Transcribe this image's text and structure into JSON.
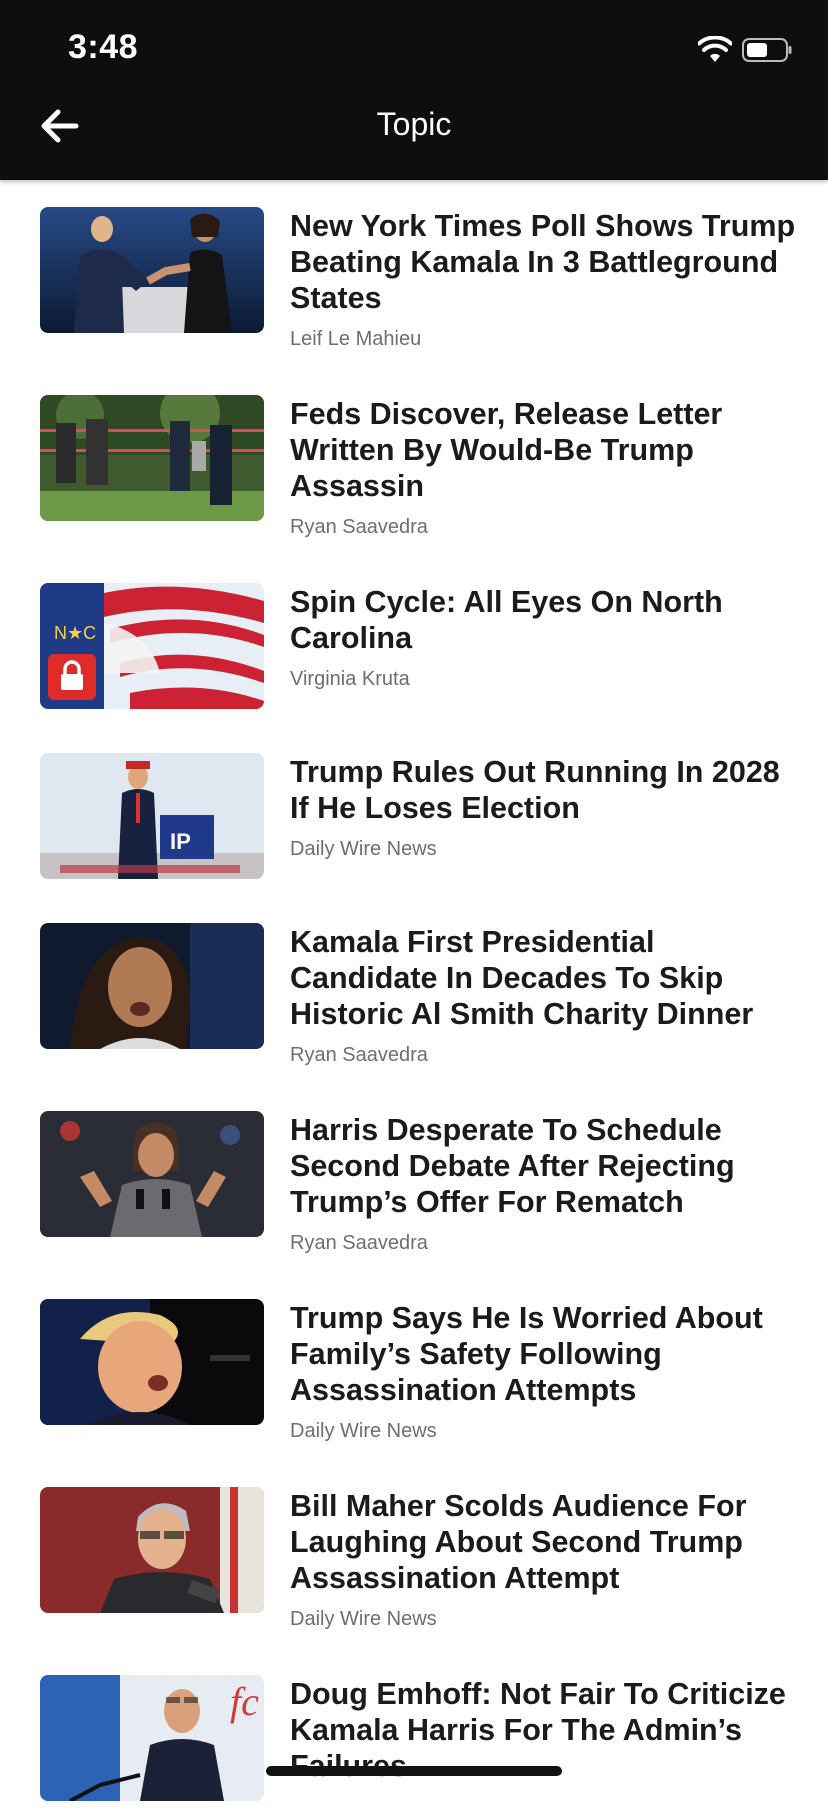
{
  "status_bar": {
    "time": "3:48"
  },
  "nav": {
    "title": "Topic"
  },
  "articles": [
    {
      "headline": "New York Times Poll Shows Trump Beating Kamala In 3 Battleground States",
      "author": "Leif Le Mahieu",
      "locked": false
    },
    {
      "headline": "Feds Discover, Release Letter Written By Would-Be Trump Assassin",
      "author": "Ryan Saavedra",
      "locked": false
    },
    {
      "headline": "Spin Cycle: All Eyes On North Carolina",
      "author": "Virginia Kruta",
      "locked": true
    },
    {
      "headline": "Trump Rules Out Running In 2028 If He Loses Election",
      "author": "Daily Wire News",
      "locked": false
    },
    {
      "headline": "Kamala First Presidential Candidate In Decades To Skip Historic Al Smith Charity Dinner",
      "author": "Ryan Saavedra",
      "locked": false
    },
    {
      "headline": "Harris Desperate To Schedule Second Debate After Rejecting Trump’s Offer For Rematch",
      "author": "Ryan Saavedra",
      "locked": false
    },
    {
      "headline": "Trump Says He Is Worried About Family’s Safety Following Assassination Attempts",
      "author": "Daily Wire News",
      "locked": false
    },
    {
      "headline": "Bill Maher Scolds Audience For Laughing About Second Trump Assassination Attempt",
      "author": "Daily Wire News",
      "locked": false
    },
    {
      "headline": "Doug Emhoff: Not Fair To Criticize Kamala Harris For The Admin’s Failures",
      "author": "",
      "locked": false
    }
  ],
  "icons": {
    "back": "arrow-left-icon",
    "lock": "lock-icon",
    "wifi": "wifi-icon",
    "battery": "battery-icon"
  }
}
